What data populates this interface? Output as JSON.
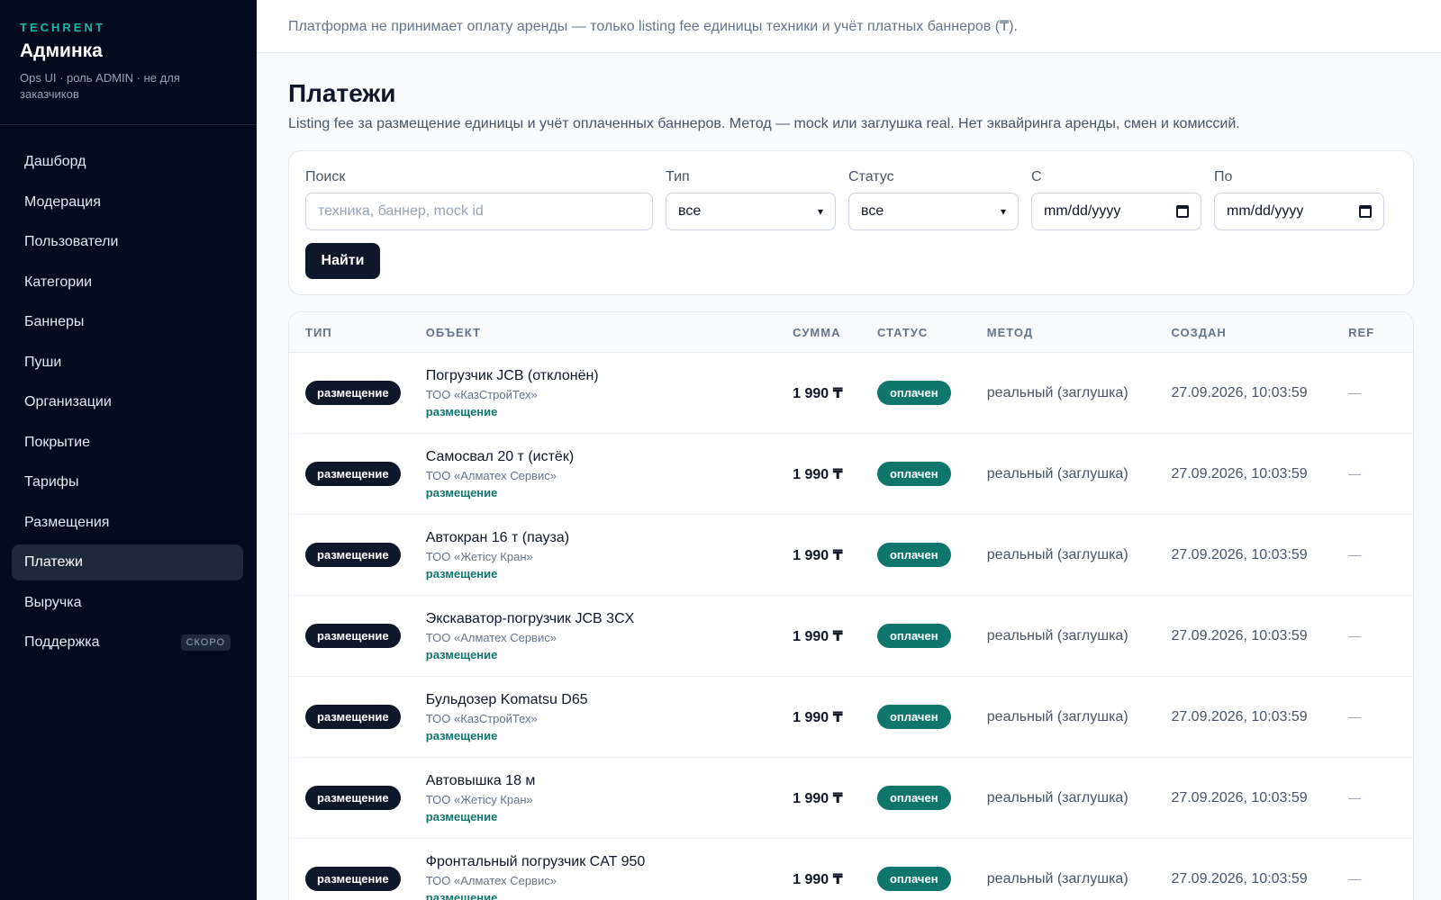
{
  "sidebar": {
    "brand_tag": "TECHRENT",
    "brand_title": "Админка",
    "brand_subtitle": "Ops UI · роль ADMIN · не для заказчиков",
    "items": [
      {
        "label": "Дашборд"
      },
      {
        "label": "Модерация"
      },
      {
        "label": "Пользователи"
      },
      {
        "label": "Категории"
      },
      {
        "label": "Баннеры"
      },
      {
        "label": "Пуши"
      },
      {
        "label": "Организации"
      },
      {
        "label": "Покрытие"
      },
      {
        "label": "Тарифы"
      },
      {
        "label": "Размещения"
      },
      {
        "label": "Платежи",
        "active": true
      },
      {
        "label": "Выручка"
      },
      {
        "label": "Поддержка",
        "badge": "СКОРО"
      }
    ]
  },
  "notice": "Платформа не принимает оплату аренды — только listing fee единицы техники и учёт платных баннеров (₸).",
  "page": {
    "title": "Платежи",
    "description": "Listing fee за размещение единицы и учёт оплаченных баннеров. Метод — mock или заглушка real. Нет эквайринга аренды, смен и комиссий."
  },
  "filters": {
    "search_label": "Поиск",
    "search_placeholder": "техника, баннер, mock id",
    "type_label": "Тип",
    "type_value": "все",
    "status_label": "Статус",
    "status_value": "все",
    "from_label": "С",
    "from_value": "mm/dd/yyyy",
    "to_label": "По",
    "to_value": "mm/dd/yyyy",
    "submit_label": "Найти"
  },
  "table": {
    "columns": [
      "ТИП",
      "ОБЪЕКТ",
      "СУММА",
      "СТАТУС",
      "МЕТОД",
      "СОЗДАН",
      "REF"
    ],
    "rows": [
      {
        "type": "размещение",
        "title": "Погрузчик JCB (отклонён)",
        "org": "ТОО «КазСтройТех»",
        "link": "размещение",
        "amount": "1 990 ₸",
        "status": "оплачен",
        "method": "реальный (заглушка)",
        "created": "27.09.2026, 10:03:59",
        "ref": "—"
      },
      {
        "type": "размещение",
        "title": "Самосвал 20 т (истёк)",
        "org": "ТОО «Алматех Сервис»",
        "link": "размещение",
        "amount": "1 990 ₸",
        "status": "оплачен",
        "method": "реальный (заглушка)",
        "created": "27.09.2026, 10:03:59",
        "ref": "—"
      },
      {
        "type": "размещение",
        "title": "Автокран 16 т (пауза)",
        "org": "ТОО «Жетісу Кран»",
        "link": "размещение",
        "amount": "1 990 ₸",
        "status": "оплачен",
        "method": "реальный (заглушка)",
        "created": "27.09.2026, 10:03:59",
        "ref": "—"
      },
      {
        "type": "размещение",
        "title": "Экскаватор-погрузчик JCB 3CX",
        "org": "ТОО «Алматех Сервис»",
        "link": "размещение",
        "amount": "1 990 ₸",
        "status": "оплачен",
        "method": "реальный (заглушка)",
        "created": "27.09.2026, 10:03:59",
        "ref": "—"
      },
      {
        "type": "размещение",
        "title": "Бульдозер Komatsu D65",
        "org": "ТОО «КазСтройТех»",
        "link": "размещение",
        "amount": "1 990 ₸",
        "status": "оплачен",
        "method": "реальный (заглушка)",
        "created": "27.09.2026, 10:03:59",
        "ref": "—"
      },
      {
        "type": "размещение",
        "title": "Автовышка 18 м",
        "org": "ТОО «Жетісу Кран»",
        "link": "размещение",
        "amount": "1 990 ₸",
        "status": "оплачен",
        "method": "реальный (заглушка)",
        "created": "27.09.2026, 10:03:59",
        "ref": "—"
      },
      {
        "type": "размещение",
        "title": "Фронтальный погрузчик CAT 950",
        "org": "ТОО «Алматех Сервис»",
        "link": "размещение",
        "amount": "1 990 ₸",
        "status": "оплачен",
        "method": "реальный (заглушка)",
        "created": "27.09.2026, 10:03:59",
        "ref": "—"
      }
    ]
  },
  "colors": {
    "sidebar_bg": "#050b1f",
    "accent_teal": "#0f766e",
    "brand_teal": "#14b8a6",
    "dark_pill": "#0f172a"
  }
}
